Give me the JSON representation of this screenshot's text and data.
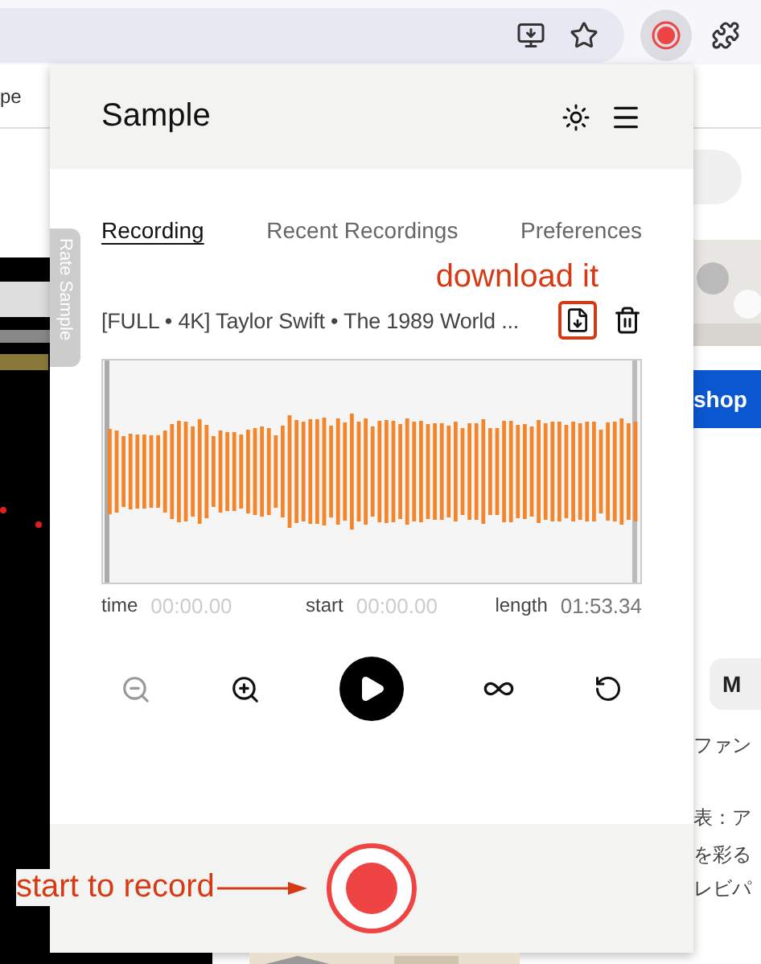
{
  "browser": {
    "bookmark": "pe"
  },
  "page": {
    "side_tab": "Rate Sample",
    "shop_button": "shop",
    "chip": "M",
    "lines": [
      "ファン",
      "表：ア",
      "を彩る",
      "レビパ"
    ]
  },
  "popup": {
    "title": "Sample",
    "tabs": [
      {
        "label": "Recording",
        "selected": true
      },
      {
        "label": "Recent Recordings",
        "selected": false
      },
      {
        "label": "Preferences",
        "selected": false
      }
    ],
    "recording_title": "[FULL • 4K] Taylor Swift • The 1989 World ...",
    "times": [
      {
        "label": "time",
        "value": "00:00.00",
        "dimmed": true
      },
      {
        "label": "start",
        "value": "00:00.00",
        "dimmed": true
      },
      {
        "label": "length",
        "value": "01:53.34",
        "dimmed": false
      }
    ],
    "controls": [
      {
        "kind": "zoom-out",
        "disabled": true
      },
      {
        "kind": "zoom-in",
        "disabled": false
      },
      {
        "kind": "play",
        "disabled": false
      },
      {
        "kind": "loop",
        "disabled": false
      },
      {
        "kind": "reset",
        "disabled": false
      }
    ]
  },
  "annotations": {
    "download": "download it",
    "record": "start to record"
  }
}
